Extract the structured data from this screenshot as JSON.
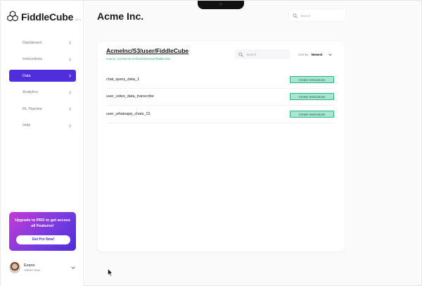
{
  "brand": {
    "name": "FiddleCube",
    "version": "v1.0"
  },
  "sidebar": {
    "items": [
      {
        "label": "Dashboard",
        "active": false
      },
      {
        "label": "Instructions",
        "active": false
      },
      {
        "label": "Data",
        "active": true
      },
      {
        "label": "Analytics",
        "active": false
      },
      {
        "label": "RL Pipeline",
        "active": false
      },
      {
        "label": "Help",
        "active": false
      }
    ],
    "promo": {
      "text": "Upgrade to PRO to get access all Features!",
      "button_label": "Get Pro Now!"
    },
    "user": {
      "name": "Evano",
      "role": "Admin User"
    }
  },
  "header": {
    "title": "Acme Inc.",
    "search_placeholder": "Search"
  },
  "card": {
    "title": "AcmeInc/S3/user/FiddleCube",
    "source": "source: s3://acme-inc/buckets/user/fiddlecube",
    "search_placeholder": "Search",
    "sort_label": "Sort by :",
    "sort_value": "Newest",
    "rows": [
      {
        "name": "chat_query_data_1",
        "action": "Create Instructions"
      },
      {
        "name": "user_video_data_transcribe",
        "action": "Create Instructions"
      },
      {
        "name": "user_whatsapp_chats_01",
        "action": "Create Instructions"
      }
    ]
  },
  "colors": {
    "accent": "#4f2ddb",
    "source_green": "#2bb589",
    "button_fill": "#a9e6d2"
  },
  "icons": [
    "logo-cube-icon",
    "chevron-right-icon",
    "chevron-down-icon",
    "search-icon",
    "cursor-icon"
  ]
}
